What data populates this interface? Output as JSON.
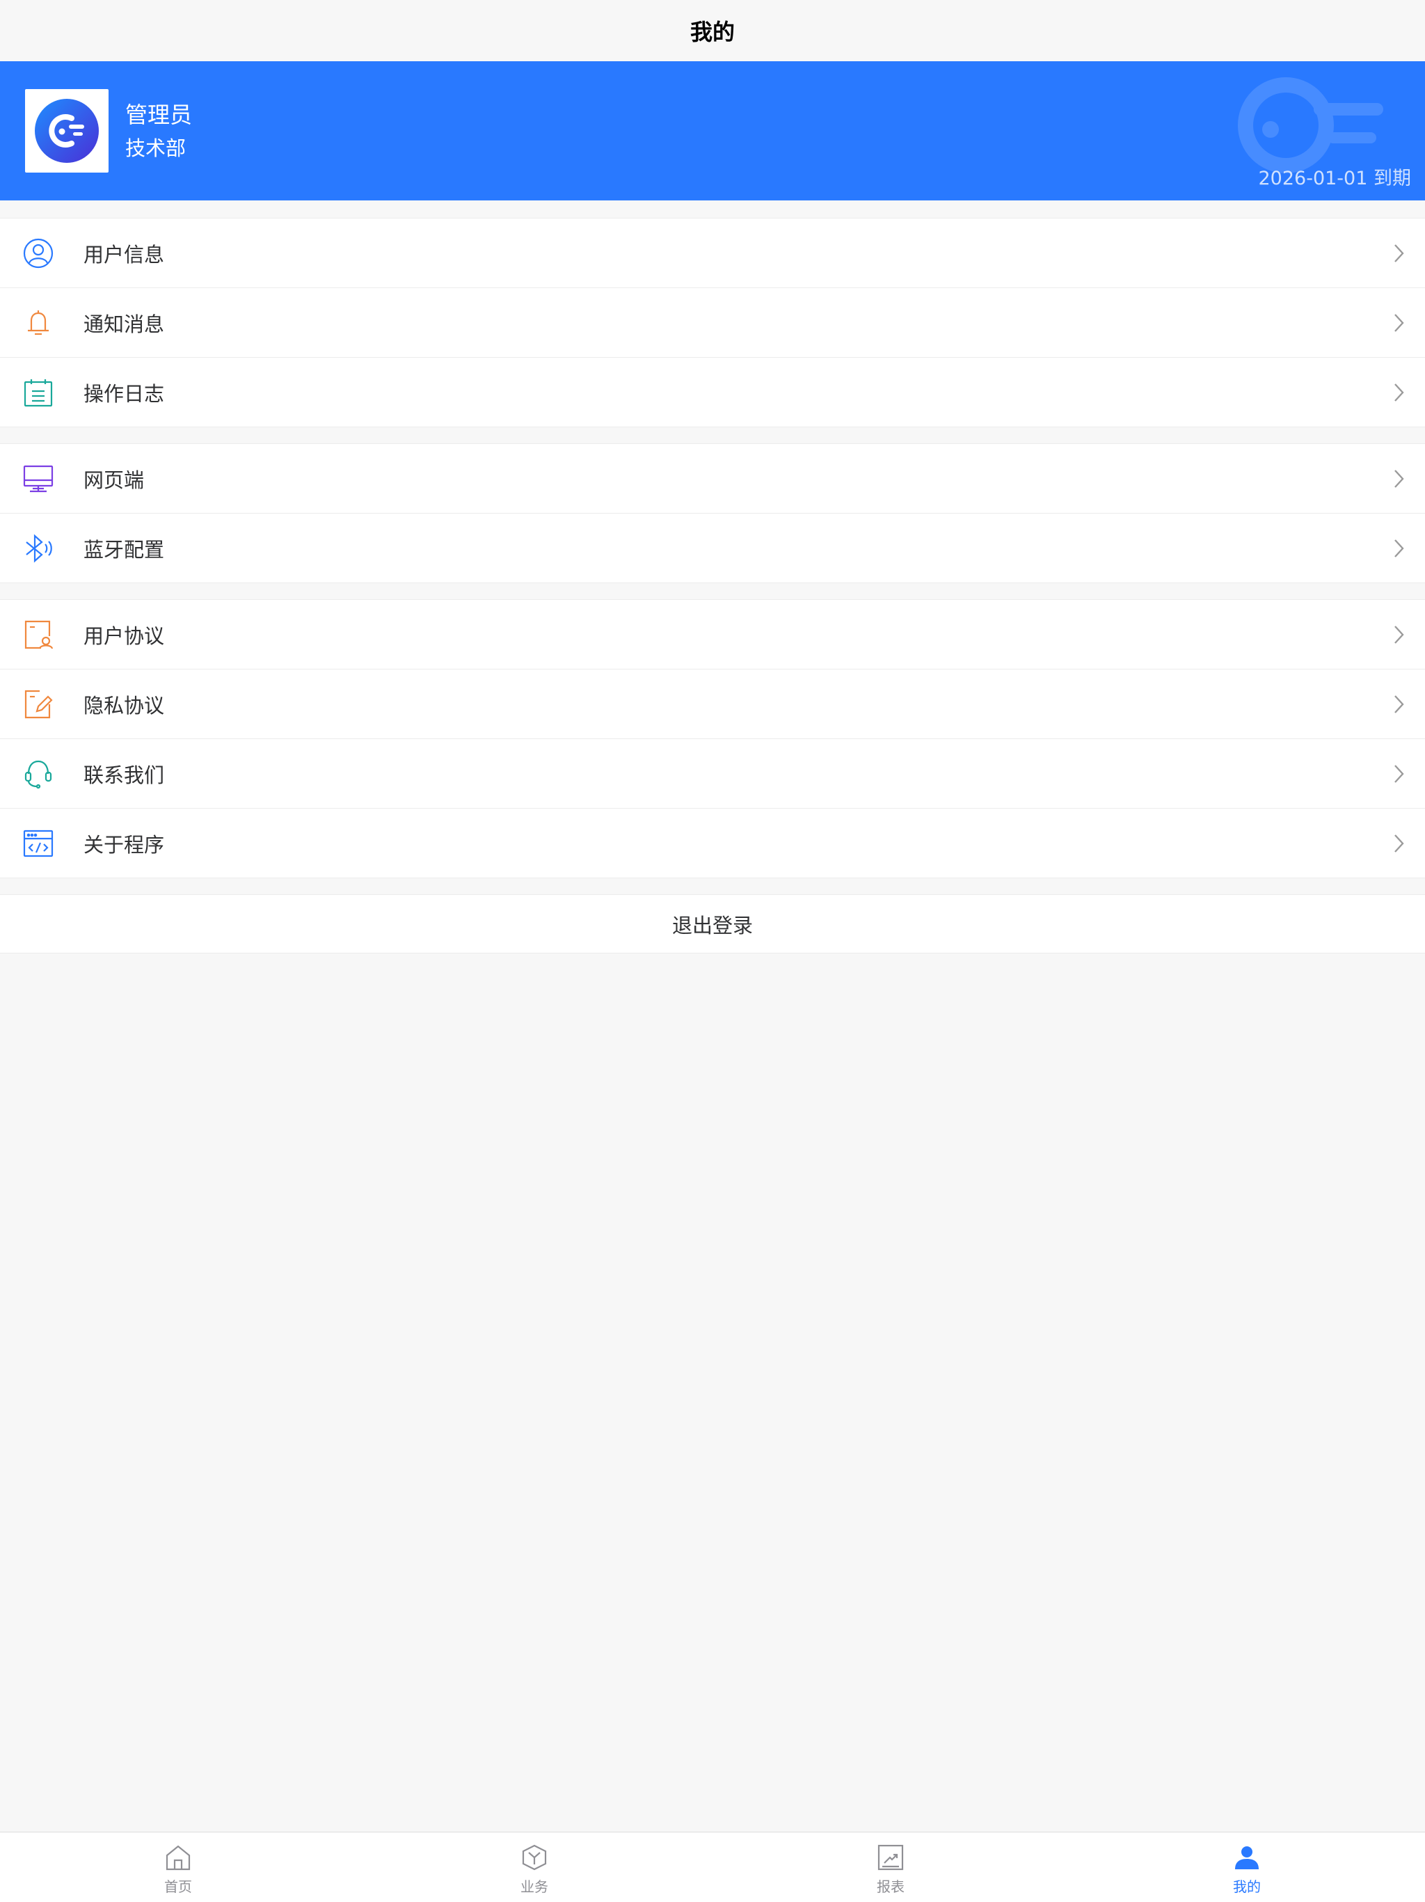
{
  "navbar": {
    "title": "我的"
  },
  "profile": {
    "name": "管理员",
    "department": "技术部",
    "expiry": "2026-01-01 到期"
  },
  "menu_groups": [
    {
      "items": [
        {
          "label": "用户信息",
          "icon": "user-circle-icon",
          "color": "#2979ff"
        },
        {
          "label": "通知消息",
          "icon": "bell-icon",
          "color": "#f0883e"
        },
        {
          "label": "操作日志",
          "icon": "calendar-log-icon",
          "color": "#19a89a"
        }
      ]
    },
    {
      "items": [
        {
          "label": "网页端",
          "icon": "monitor-icon",
          "color": "#7b3fe4"
        },
        {
          "label": "蓝牙配置",
          "icon": "bluetooth-icon",
          "color": "#2979ff"
        }
      ]
    },
    {
      "items": [
        {
          "label": "用户协议",
          "icon": "user-document-icon",
          "color": "#f0883e"
        },
        {
          "label": "隐私协议",
          "icon": "edit-document-icon",
          "color": "#f0883e"
        },
        {
          "label": "联系我们",
          "icon": "headset-icon",
          "color": "#19a89a"
        },
        {
          "label": "关于程序",
          "icon": "code-window-icon",
          "color": "#2979ff"
        }
      ]
    }
  ],
  "logout": {
    "label": "退出登录"
  },
  "tabbar": {
    "tabs": [
      {
        "label": "首页",
        "icon": "home-icon",
        "active": false
      },
      {
        "label": "业务",
        "icon": "cube-icon",
        "active": false
      },
      {
        "label": "报表",
        "icon": "chart-icon",
        "active": false
      },
      {
        "label": "我的",
        "icon": "person-icon",
        "active": true
      }
    ]
  },
  "colors": {
    "brand": "#2979ff",
    "background": "#f7f7f7",
    "text": "#303133",
    "inactive_tab": "#8f8f94"
  }
}
